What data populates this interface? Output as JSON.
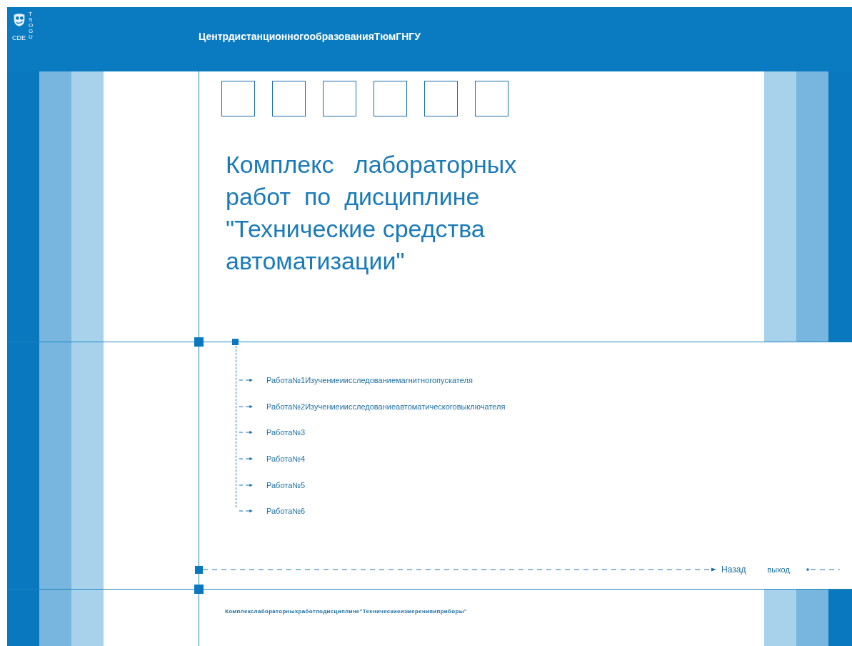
{
  "header": {
    "logo_text": "CDE",
    "logo_side_text": "TSOGU",
    "title": "ЦентрдистанционногообразованияТюмГНГУ"
  },
  "course_title": [
    "Комплекс   лабораторных",
    "работ  по  дисциплине",
    "\"Технические средства",
    "автоматизации\""
  ],
  "works": [
    {
      "label": "Работа№1Изучениеиисследованиемагнитногопускателя"
    },
    {
      "label": "Работа№2Изучениеиисследованиеавтоматическоговыключателя"
    },
    {
      "label": "Работа№3"
    },
    {
      "label": "Работа№4"
    },
    {
      "label": "Работа№5"
    },
    {
      "label": "Работа№6"
    }
  ],
  "nav": {
    "back": "Назад",
    "exit": "выход"
  },
  "footer_text": "Комплекслабораторныхработподисциплине\"Техническиеизмеренияиприборы\""
}
